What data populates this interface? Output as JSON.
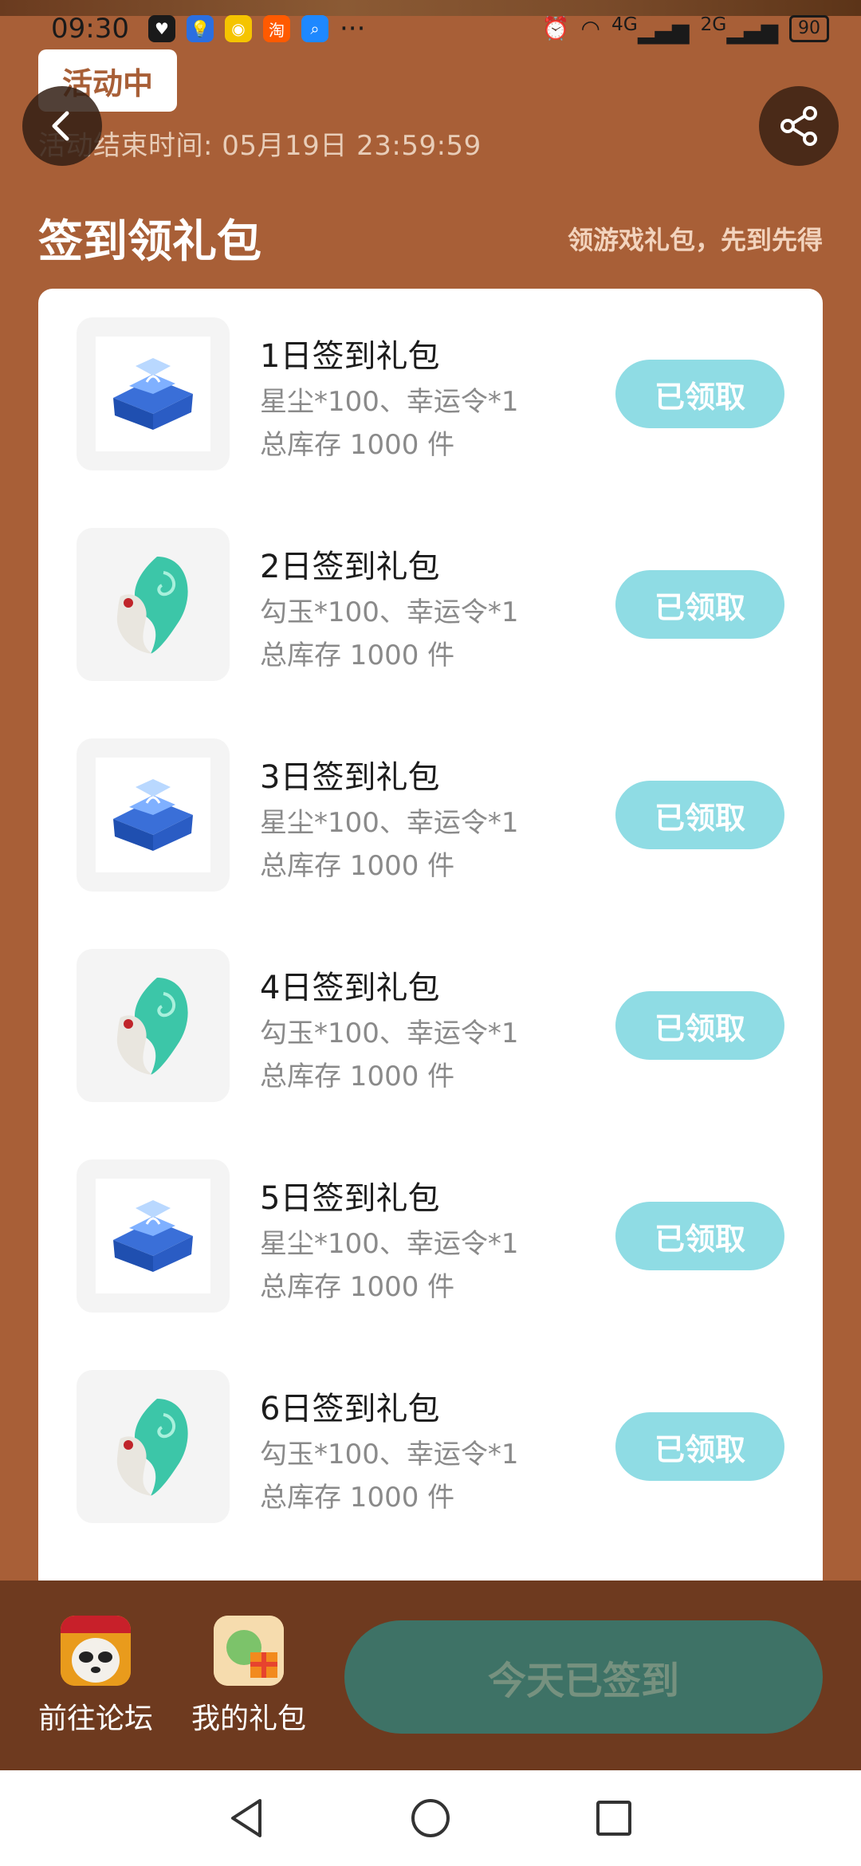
{
  "status_bar": {
    "time": "09:30",
    "app_icons": [
      "heart-icon",
      "lightbulb-icon",
      "weibo-icon",
      "taobao-icon",
      "search-app-icon"
    ],
    "more": "···",
    "signal_4g": "4G",
    "signal_2g": "2G",
    "battery": "90"
  },
  "header": {
    "status_chip": "活动中",
    "end_time": "活动结束时间: 05月19日 23:59:59",
    "section_title": "签到领礼包",
    "section_subtitle": "领游戏礼包，先到先得"
  },
  "gifts": [
    {
      "name": "1日签到礼包",
      "desc": "星尘*100、幸运令*1",
      "stock": "总库存 1000 件",
      "button": "已领取",
      "icon": "treasure-chest-icon"
    },
    {
      "name": "2日签到礼包",
      "desc": "勾玉*100、幸运令*1",
      "stock": "总库存 1000 件",
      "button": "已领取",
      "icon": "magatama-icon"
    },
    {
      "name": "3日签到礼包",
      "desc": "星尘*100、幸运令*1",
      "stock": "总库存 1000 件",
      "button": "已领取",
      "icon": "treasure-chest-icon"
    },
    {
      "name": "4日签到礼包",
      "desc": "勾玉*100、幸运令*1",
      "stock": "总库存 1000 件",
      "button": "已领取",
      "icon": "magatama-icon"
    },
    {
      "name": "5日签到礼包",
      "desc": "星尘*100、幸运令*1",
      "stock": "总库存 1000 件",
      "button": "已领取",
      "icon": "treasure-chest-icon"
    },
    {
      "name": "6日签到礼包",
      "desc": "勾玉*100、幸运令*1",
      "stock": "总库存 1000 件",
      "button": "已领取",
      "icon": "magatama-icon"
    }
  ],
  "bottom_bar": {
    "forum_label": "前往论坛",
    "my_gifts_label": "我的礼包",
    "checkin_button": "今天已签到"
  },
  "colors": {
    "page_bg": "#a85f37",
    "bottom_bar_bg": "#6e3a1f",
    "claimed_button": "#8fdce4",
    "checkin_button": "#3e7266"
  }
}
